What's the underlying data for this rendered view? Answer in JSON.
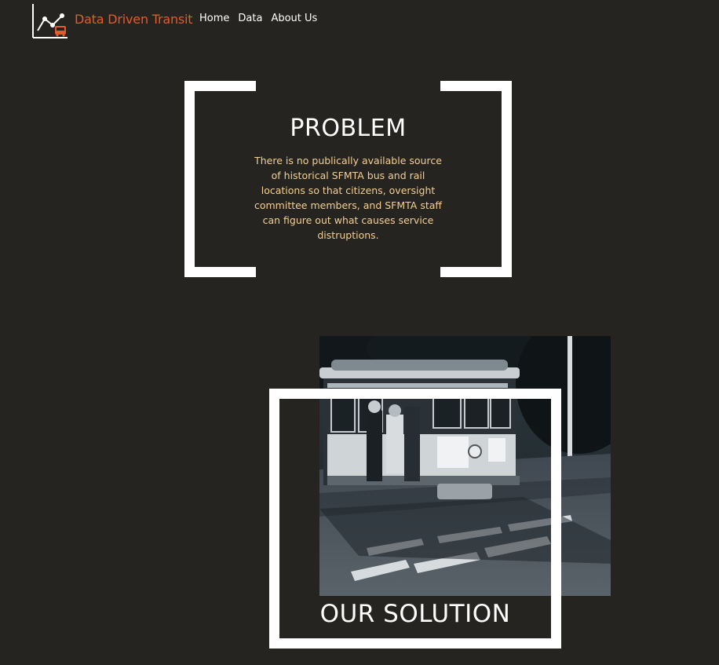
{
  "header": {
    "brand": "Data Driven Transit",
    "logo_icon": "line-chart-bus-icon",
    "nav": [
      {
        "label": "Home"
      },
      {
        "label": "Data"
      },
      {
        "label": "About Us"
      }
    ]
  },
  "problem": {
    "title": "PROBLEM",
    "text": "There is no publically available source of historical SFMTA bus and rail locations so that citizens, oversight committee members, and SFMTA staff can figure out what causes service distruptions."
  },
  "solution": {
    "title": "OUR SOLUTION",
    "photo_icon": "cable-car-photo"
  },
  "colors": {
    "background": "#262420",
    "brand": "#e55a2b",
    "problem_text": "#f3cf92",
    "frame": "#ffffff"
  }
}
